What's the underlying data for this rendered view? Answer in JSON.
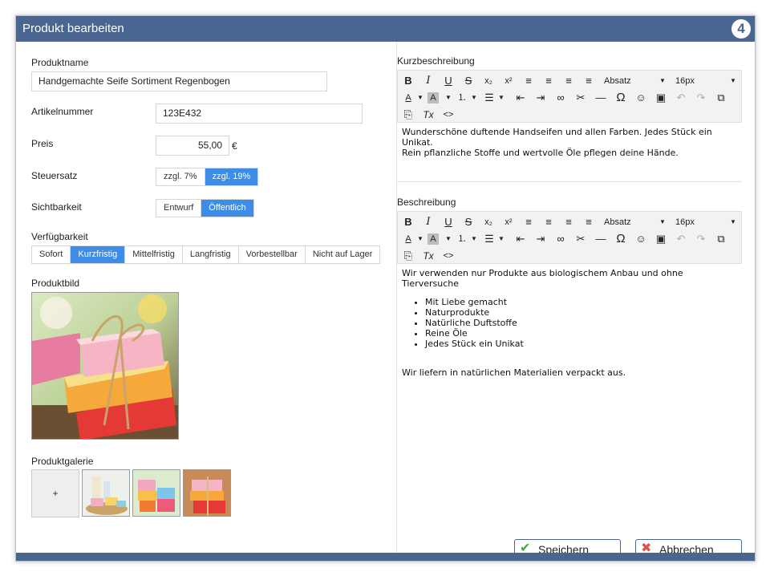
{
  "window": {
    "title": "Produkt bearbeiten",
    "logo_glyph": "4"
  },
  "form": {
    "name_label": "Produktname",
    "name_value": "Handgemachte Seife Sortiment Regenbogen",
    "sku_label": "Artikelnummer",
    "sku_value": "123E432",
    "price_label": "Preis",
    "price_value": "55,00",
    "currency": "€",
    "tax_label": "Steuersatz",
    "tax_options": [
      "zzgl. 7%",
      "zzgl. 19%"
    ],
    "tax_selected": "zzgl. 19%",
    "visibility_label": "Sichtbarkeit",
    "visibility_options": [
      "Entwurf",
      "Öffentlich"
    ],
    "visibility_selected": "Öffentlich",
    "availability_label": "Verfügbarkeit",
    "availability_options": [
      "Sofort",
      "Kurzfristig",
      "Mittelfristig",
      "Langfristig",
      "Vorbestellbar",
      "Nicht auf Lager"
    ],
    "availability_selected": "Kurzfristig",
    "image_label": "Produktbild",
    "gallery_label": "Produktgalerie",
    "gallery_add": "+"
  },
  "short_desc": {
    "label": "Kurzbeschreibung",
    "lines": [
      "Wunderschöne duftende Handseifen und allen Farben. Jedes Stück ein Unikat.",
      "Rein pflanzliche Stoffe und wertvolle Öle pflegen deine Hände."
    ]
  },
  "description": {
    "label": "Beschreibung",
    "intro": "Wir verwenden nur Produkte aus biologischem Anbau und ohne Tierversuche",
    "items": [
      "Mit Liebe gemacht",
      "Naturprodukte",
      "Natürliche Duftstoffe",
      "Reine Öle",
      "Jedes Stück ein Unikat"
    ],
    "outro": "Wir liefern in natürlichen Materialien verpackt aus."
  },
  "toolbar": {
    "format_select": "Absatz",
    "size_select": "16px",
    "bold": "B",
    "italic": "I",
    "underline": "U",
    "strike": "S",
    "subscript": "x₂",
    "superscript": "x²",
    "omega": "Ω",
    "hr": "—",
    "code": "<>",
    "clear": "Tx",
    "textcolor": "A",
    "bgcolor": "A"
  },
  "actions": {
    "save": "Speichern",
    "cancel": "Abbrechen"
  },
  "colors": {
    "header": "#4a6590",
    "accent": "#3d8ce5",
    "save_icon": "#3dab3d",
    "cancel_icon": "#e0514c"
  }
}
